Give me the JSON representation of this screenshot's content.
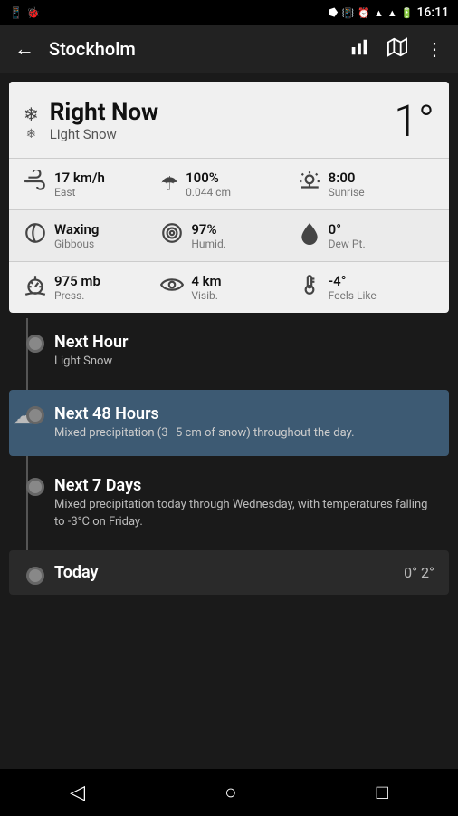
{
  "statusBar": {
    "time": "16:11",
    "icons": [
      "battery",
      "wifi",
      "signal",
      "alarm",
      "vibrate",
      "bluetooth"
    ]
  },
  "toolbar": {
    "backLabel": "←",
    "title": "Stockholm",
    "icons": [
      "bar-chart-icon",
      "map-icon",
      "more-icon"
    ]
  },
  "currentWeather": {
    "title": "Right Now",
    "condition": "Light Snow",
    "temperature": "1°",
    "snowIconTop": "❄",
    "snowIconBottom": "❄"
  },
  "statsRow1": [
    {
      "icon": "wind-icon",
      "value": "17 km/h",
      "label": "East"
    },
    {
      "icon": "umbrella-icon",
      "value": "100%",
      "label": "0.044 cm"
    },
    {
      "icon": "sunrise-icon",
      "value": "8:00",
      "label": "Sunrise"
    }
  ],
  "statsRow2": [
    {
      "icon": "moon-icon",
      "value": "Waxing",
      "label": "Gibbous"
    },
    {
      "icon": "humidity-icon",
      "value": "97%",
      "label": "Humid."
    },
    {
      "icon": "drop-icon",
      "value": "0°",
      "label": "Dew Pt."
    }
  ],
  "statsRow3": [
    {
      "icon": "pressure-icon",
      "value": "975 mb",
      "label": "Press."
    },
    {
      "icon": "eye-icon",
      "value": "4 km",
      "label": "Visib."
    },
    {
      "icon": "thermometer-icon",
      "value": "-4°",
      "label": "Feels Like"
    }
  ],
  "timeline": [
    {
      "id": "next-hour",
      "title": "Next Hour",
      "description": "Light Snow",
      "highlighted": false,
      "icon": null
    },
    {
      "id": "next-48-hours",
      "title": "Next 48 Hours",
      "description": "Mixed precipitation (3–5 cm of snow) throughout the day.",
      "highlighted": true,
      "icon": "cloud-snow-icon"
    },
    {
      "id": "next-7-days",
      "title": "Next 7 Days",
      "description": "Mixed precipitation today through Wednesday, with temperatures falling to -3°C on Friday.",
      "highlighted": false,
      "icon": null
    }
  ],
  "todayPeek": {
    "title": "Today",
    "temps": "0° 2°"
  },
  "bottomNav": {
    "back": "◁",
    "home": "○",
    "recent": "□"
  }
}
